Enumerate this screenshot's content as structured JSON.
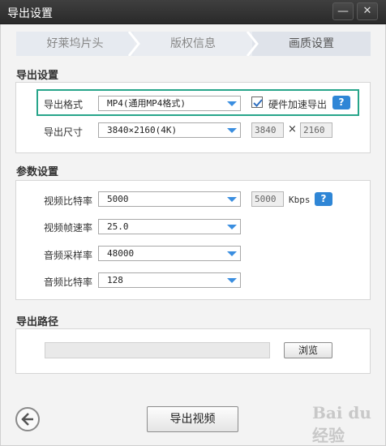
{
  "window": {
    "title": "导出设置",
    "min_glyph": "—",
    "close_glyph": "✕"
  },
  "steps": [
    "好莱坞片头",
    "版权信息",
    "画质设置"
  ],
  "export_settings": {
    "title": "导出设置",
    "format_label": "导出格式",
    "format_value": "MP4(通用MP4格式)",
    "hw_accel_label": "硬件加速导出",
    "hw_accel_checked": true,
    "size_label": "导出尺寸",
    "size_value": "3840×2160(4K)",
    "width": "3840",
    "times": "×",
    "height": "2160"
  },
  "params": {
    "title": "参数设置",
    "video_bitrate_label": "视频比特率",
    "video_bitrate_value": "5000",
    "video_bitrate_input": "5000",
    "bitrate_unit": "Kbps",
    "framerate_label": "视频帧速率",
    "framerate_value": "25.0",
    "samplerate_label": "音频采样率",
    "samplerate_value": "48000",
    "audio_bitrate_label": "音频比特率",
    "audio_bitrate_value": "128"
  },
  "help_glyph": "?",
  "export_path": {
    "title": "导出路径",
    "path_value": "",
    "browse_label": "浏览"
  },
  "footer": {
    "export_button": "导出视频"
  },
  "watermark": "Bai du 经验",
  "colors": {
    "accent": "#2f86d6",
    "highlight": "#27a58a",
    "titlebar": "#333333"
  }
}
